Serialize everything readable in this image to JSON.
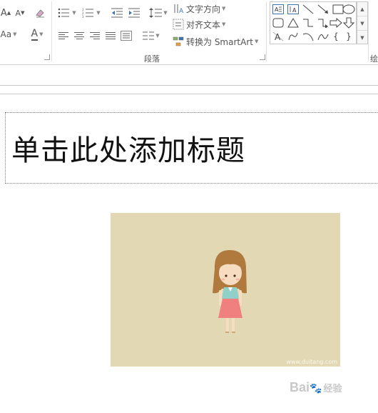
{
  "ribbon": {
    "paragraph": {
      "text_direction_label": "文字方向",
      "align_text_label": "对齐文本",
      "convert_smartart_label": "转换为 SmartArt",
      "group_label": "段落"
    },
    "font_partial": {
      "change_case_label": "Aa",
      "font_color_label": "A",
      "grow_font_label": "A",
      "shrink_font_label": "A"
    },
    "drawing_partial_label": "绘"
  },
  "slide": {
    "title_placeholder": "单击此处添加标题",
    "picture_watermark": "www.duitang.com"
  },
  "watermark": {
    "brand": "Bai",
    "brand_suffix": "经验"
  }
}
